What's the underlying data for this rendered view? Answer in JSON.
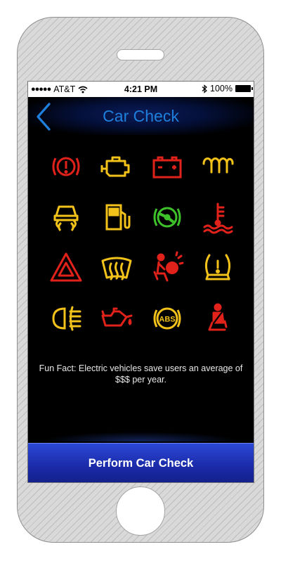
{
  "status_bar": {
    "carrier": "AT&T",
    "time": "4:21 PM",
    "battery": "100%",
    "signal_icon": "signal-dots-icon",
    "wifi_icon": "wifi-icon",
    "bluetooth_icon": "bluetooth-icon"
  },
  "nav": {
    "title": "Car Check",
    "back_icon": "chevron-left-icon"
  },
  "colors": {
    "title_blue": "#1f7fdc",
    "warning_red": "#e0221b",
    "warning_yellow": "#f2c21b",
    "indicator_green": "#3ec22a",
    "button_blue": "#1f35c0"
  },
  "warning_lights": [
    {
      "name": "brake-warning-icon",
      "color": "red"
    },
    {
      "name": "check-engine-icon",
      "color": "yellow"
    },
    {
      "name": "battery-icon",
      "color": "red"
    },
    {
      "name": "glow-plug-icon",
      "color": "yellow"
    },
    {
      "name": "traction-control-icon",
      "color": "yellow"
    },
    {
      "name": "low-fuel-icon",
      "color": "yellow"
    },
    {
      "name": "power-steering-icon",
      "color": "green"
    },
    {
      "name": "coolant-temperature-icon",
      "color": "red"
    },
    {
      "name": "hazard-triangle-icon",
      "color": "red"
    },
    {
      "name": "rear-defrost-icon",
      "color": "yellow"
    },
    {
      "name": "airbag-icon",
      "color": "red"
    },
    {
      "name": "tire-pressure-icon",
      "color": "yellow"
    },
    {
      "name": "fog-light-icon",
      "color": "yellow"
    },
    {
      "name": "oil-pressure-icon",
      "color": "red"
    },
    {
      "name": "abs-icon",
      "color": "yellow",
      "label": "ABS"
    },
    {
      "name": "seatbelt-icon",
      "color": "red"
    }
  ],
  "fun_fact": "Fun Fact: Electric vehicles save users an average of $$$ per year.",
  "action_button": "Perform Car Check"
}
